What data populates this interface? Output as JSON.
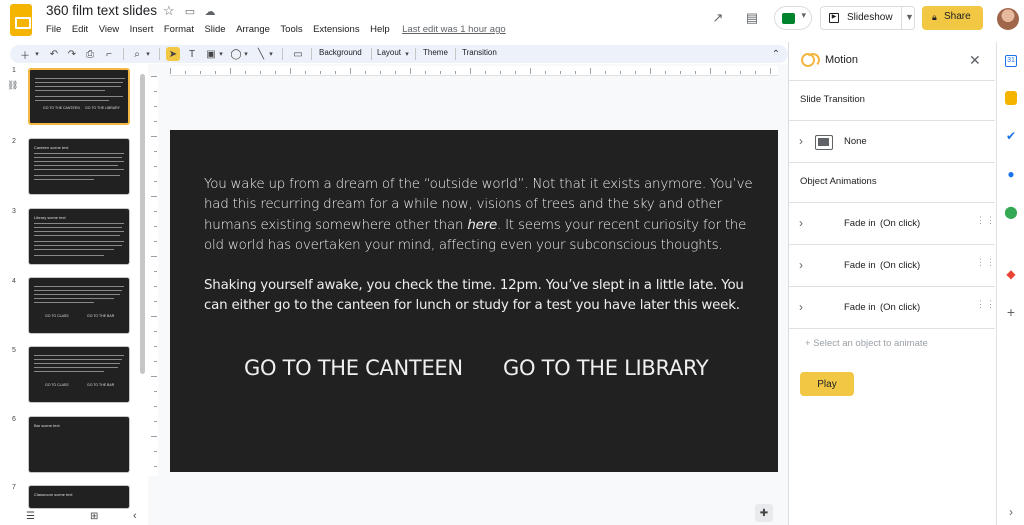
{
  "app": {
    "doc_title": "360 film text slides",
    "last_edit": "Last edit was 1 hour ago",
    "menu": [
      "File",
      "Edit",
      "View",
      "Insert",
      "Format",
      "Slide",
      "Arrange",
      "Tools",
      "Extensions",
      "Help"
    ],
    "slideshow_label": "Slideshow",
    "share_label": "Share",
    "brand_color": "#f2b843"
  },
  "toolbar": {
    "background": "Background",
    "layout": "Layout",
    "theme": "Theme",
    "transition": "Transition"
  },
  "filmstrip": {
    "slides": [
      {
        "num": "1",
        "title": "",
        "buttons": [
          "GO TO THE CANTEEN",
          "GO TO THE LIBRARY"
        ],
        "selected": true
      },
      {
        "num": "2",
        "title": "Canteen scene text",
        "buttons": []
      },
      {
        "num": "3",
        "title": "Library scene text",
        "buttons": []
      },
      {
        "num": "4",
        "title": "",
        "buttons": [
          "GO TO CLASS",
          "GO TO THE BAR"
        ]
      },
      {
        "num": "5",
        "title": "",
        "buttons": [
          "GO TO CLASS",
          "GO TO THE BAR"
        ]
      },
      {
        "num": "6",
        "title": "Bar scene text",
        "buttons": []
      },
      {
        "num": "7",
        "title": "Classroom scene text",
        "buttons": []
      }
    ]
  },
  "slide": {
    "para1_before": "You wake up from a dream of the “outside world”. Not that it exists anymore. You’ve had this recurring dream for a while now, visions of trees and the sky and other humans existing somewhere other than ",
    "para1_em": "here",
    "para1_after": ". It seems your recent curiosity for the old world has overtaken your mind, affecting even your subconscious thoughts.",
    "para2": "Shaking yourself awake, you check the time. 12pm. You’ve slept in a little late. You can either go to the canteen for lunch or study for a test you have later this week.",
    "link_canteen": "GO TO THE CANTEEN",
    "link_library": "GO TO THE LIBRARY"
  },
  "motion_panel": {
    "title": "Motion",
    "slide_transition_label": "Slide Transition",
    "transition_value": "None",
    "object_animations_label": "Object Animations",
    "animations": [
      {
        "effect": "Fade in",
        "trigger": "(On click)"
      },
      {
        "effect": "Fade in",
        "trigger": "(On click)"
      },
      {
        "effect": "Fade in",
        "trigger": "(On click)"
      }
    ],
    "add_object_placeholder": "Select an object to animate",
    "play_label": "Play"
  },
  "side_apps": [
    "calendar-icon",
    "keep-icon",
    "tasks-icon",
    "contacts-icon",
    "maps-icon",
    "office-icon",
    "add-icon"
  ],
  "side_colors": [
    "#1a73e8",
    "#f4b400",
    "#1a73e8",
    "#1a73e8",
    "#34a853",
    "#ea4335",
    "#5f6368"
  ]
}
